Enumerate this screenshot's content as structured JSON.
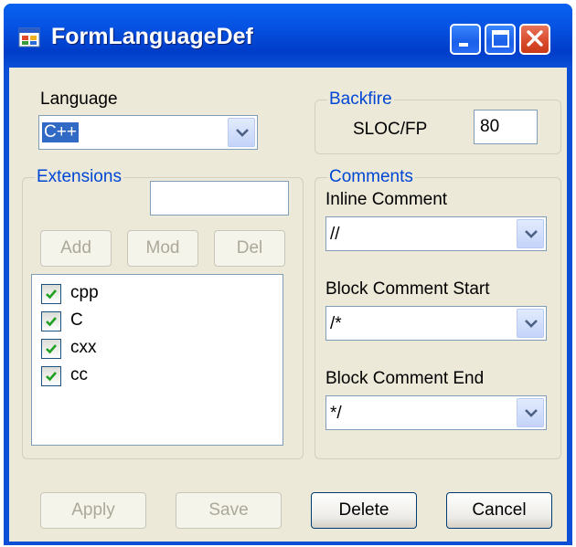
{
  "window": {
    "title": "FormLanguageDef"
  },
  "language": {
    "label": "Language",
    "selected": "C++"
  },
  "backfire": {
    "legend": "Backfire",
    "sloc_label": "SLOC/FP",
    "sloc_value": "80"
  },
  "extensions": {
    "legend": "Extensions",
    "input_value": "",
    "buttons": {
      "add": "Add",
      "mod": "Mod",
      "del": "Del"
    },
    "items": [
      {
        "label": "cpp",
        "checked": true
      },
      {
        "label": "C",
        "checked": true
      },
      {
        "label": "cxx",
        "checked": true
      },
      {
        "label": "cc",
        "checked": true
      }
    ]
  },
  "comments": {
    "legend": "Comments",
    "inline_label": "Inline Comment",
    "inline_value": "//",
    "block_start_label": "Block Comment Start",
    "block_start_value": "/*",
    "block_end_label": "Block Comment End",
    "block_end_value": "*/"
  },
  "footer": {
    "apply": "Apply",
    "save": "Save",
    "delete": "Delete",
    "cancel": "Cancel"
  },
  "icons": {
    "app": "app-window-icon",
    "minimize": "minimize-icon",
    "maximize": "maximize-icon",
    "close": "close-icon",
    "dropdown": "chevron-down-icon",
    "check": "checkmark-icon"
  },
  "colors": {
    "title_bar": "#0a4fd6",
    "client_bg": "#ece9d8",
    "group_label": "#0046d5",
    "selection": "#316ac5",
    "close_button": "#d84a2a"
  }
}
